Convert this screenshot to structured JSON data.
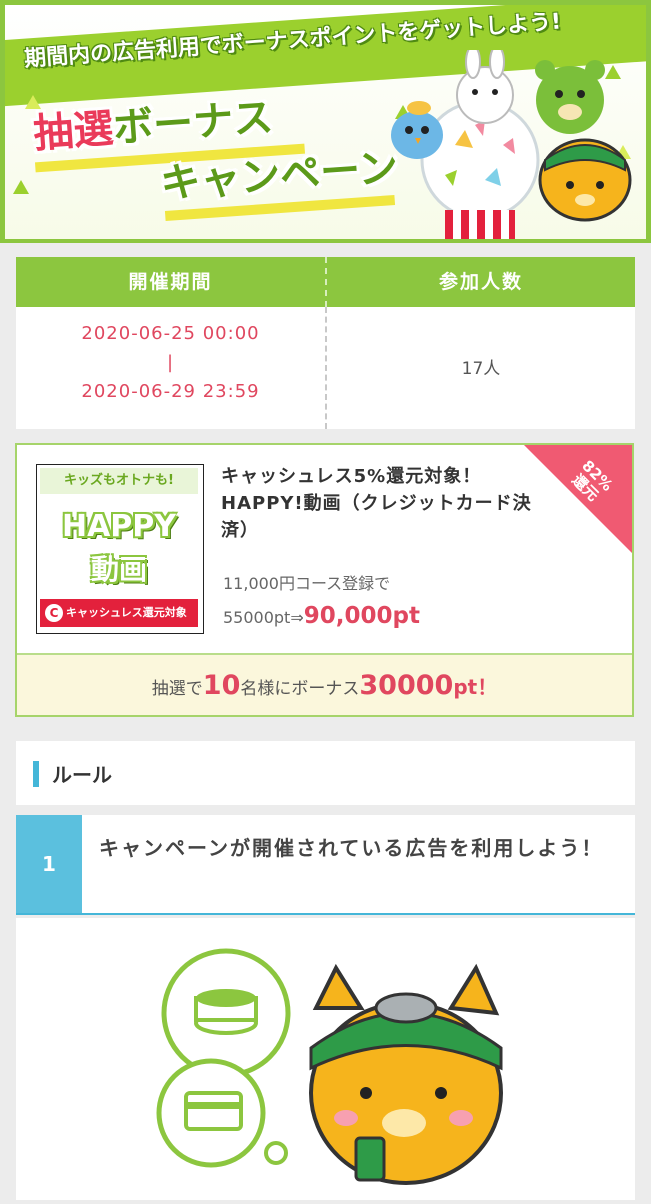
{
  "banner": {
    "headline": "期間内の広告利用でボーナスポイントをゲットしよう!",
    "title_red": "抽選",
    "title_green": "ボーナス",
    "title_line2": "キャンペーン"
  },
  "info": {
    "period_label": "開催期間",
    "participants_label": "参加人数",
    "start": "2020-06-25 00:00",
    "separator": "|",
    "end": "2020-06-29 23:59",
    "participants": "17人"
  },
  "ad": {
    "thumb_top": "キッズもオトナも!",
    "thumb_logo_line1": "HAPPY",
    "thumb_logo_line2": "動画",
    "thumb_badge": "キャッシュレス還元対象",
    "thumb_badge_icon": "C",
    "title": "キャッシュレス5%還元対象！HAPPY!動画（クレジットカード決済）",
    "course": "11,000円コース登録で",
    "points_before": "55000pt⇒",
    "points_after": "90,000pt",
    "ribbon_line1": "82%",
    "ribbon_line2": "還元",
    "bonus_prefix": "抽選で",
    "bonus_count": "10",
    "bonus_mid": "名様にボーナス",
    "bonus_points": "30000",
    "bonus_suffix": "pt！"
  },
  "rules": {
    "heading": "ルール",
    "steps": [
      {
        "number": "1",
        "text": "キャンペーンが開催されている広告を利用しよう！"
      }
    ]
  },
  "colors": {
    "green": "#8cc63f",
    "pink": "#e0475f",
    "blue": "#5bc0de",
    "yellow": "#f0e640"
  }
}
